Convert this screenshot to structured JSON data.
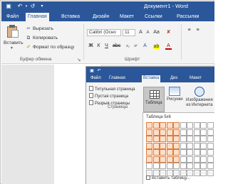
{
  "window": {
    "title": "Документ1 - Word",
    "accent_color": "#2b579a"
  },
  "quick_access": {
    "save_icon": "save-icon",
    "undo_icon": "undo-icon",
    "redo_icon": "redo-icon"
  },
  "tabs": [
    {
      "label": "Файл"
    },
    {
      "label": "Главная"
    },
    {
      "label": "Вставка"
    },
    {
      "label": "Дизайн"
    },
    {
      "label": "Макет"
    },
    {
      "label": "Ссылки"
    },
    {
      "label": "Рассылки"
    }
  ],
  "clipboard": {
    "paste_label": "Вставить",
    "cut_label": "Вырезать",
    "copy_label": "Копировать",
    "format_painter_label": "Формат по образцу",
    "group_label": "Буфер обмена"
  },
  "font": {
    "font_name": "Calibri (Осно",
    "font_size": "11",
    "bold": "Ж",
    "italic": "К",
    "underline": "Ч",
    "font_color": "A",
    "group_label": "Шрифт"
  },
  "inset": {
    "tabs": [
      {
        "label": "Файл"
      },
      {
        "label": "Главная"
      },
      {
        "label": "Вставка"
      },
      {
        "label": "Диз"
      },
      {
        "label": "Макет"
      }
    ],
    "pages": {
      "cover_label": "Титульная страница",
      "blank_label": "Пустая страница",
      "break_label": "Разрыв страницы",
      "group_label": "Страницы"
    },
    "table_button_label": "Таблица",
    "pictures_label": "Рисунки",
    "online_pictures_label_1": "Изображения",
    "online_pictures_label_2": "из Интернета",
    "dropdown": {
      "title": "Таблица 5x6",
      "insert_table_label": "Вставить таблицу...",
      "grid_cols": 10,
      "grid_rows": 8,
      "selected_cols": 5,
      "selected_rows": 6
    }
  }
}
